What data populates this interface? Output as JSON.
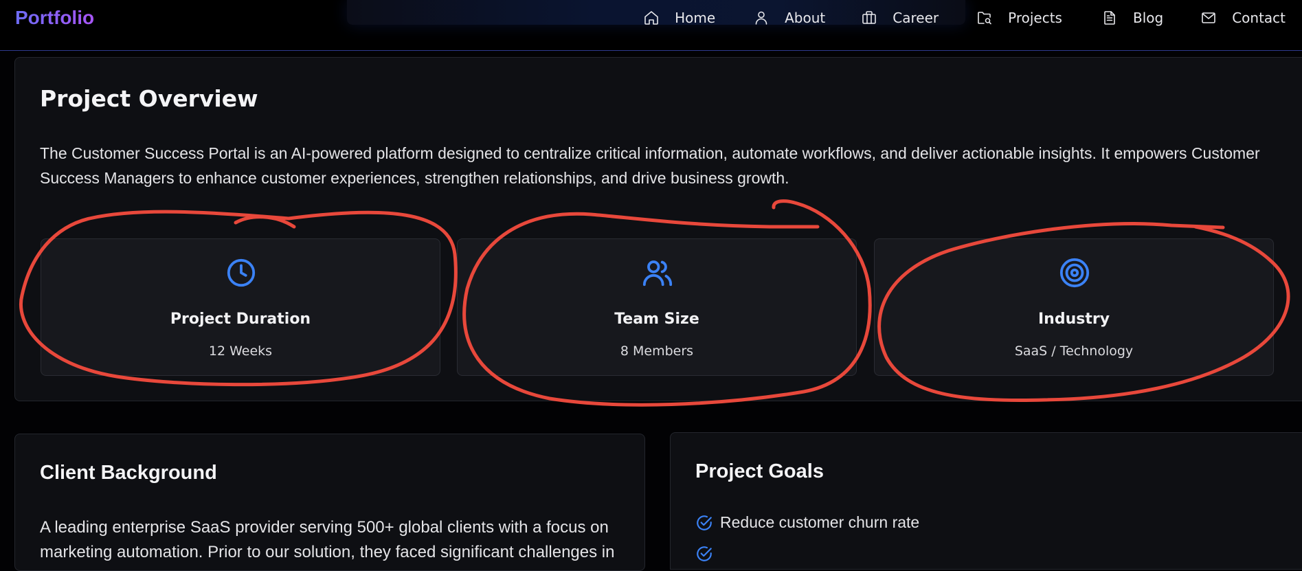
{
  "nav": {
    "logo": "Portfolio",
    "items": [
      {
        "label": "Home",
        "icon": "home-icon"
      },
      {
        "label": "About",
        "icon": "user-icon"
      },
      {
        "label": "Career",
        "icon": "briefcase-icon"
      },
      {
        "label": "Projects",
        "icon": "folder-search-icon"
      },
      {
        "label": "Blog",
        "icon": "document-icon"
      },
      {
        "label": "Contact",
        "icon": "mail-icon"
      }
    ]
  },
  "overview": {
    "title": "Project Overview",
    "description": "The Customer Success Portal is an AI-powered platform designed to centralize critical information, automate workflows, and deliver actionable insights. It empowers Customer Success Managers to enhance customer experiences, strengthen relationships, and drive business growth.",
    "stats": [
      {
        "icon": "clock-icon",
        "label": "Project Duration",
        "value": "12 Weeks"
      },
      {
        "icon": "users-icon",
        "label": "Team Size",
        "value": "8 Members"
      },
      {
        "icon": "target-icon",
        "label": "Industry",
        "value": "SaaS / Technology"
      }
    ]
  },
  "client": {
    "title": "Client Background",
    "description": "A leading enterprise SaaS provider serving 500+ global clients with a focus on marketing automation. Prior to our solution, they faced significant challenges in"
  },
  "goals": {
    "title": "Project Goals",
    "items": [
      "Reduce customer churn rate",
      ""
    ]
  },
  "colors": {
    "accent_blue": "#3b82f6",
    "logo_gradient_start": "#6d6cf5",
    "logo_gradient_end": "#a855f7",
    "annotation_red": "#e8483b"
  }
}
